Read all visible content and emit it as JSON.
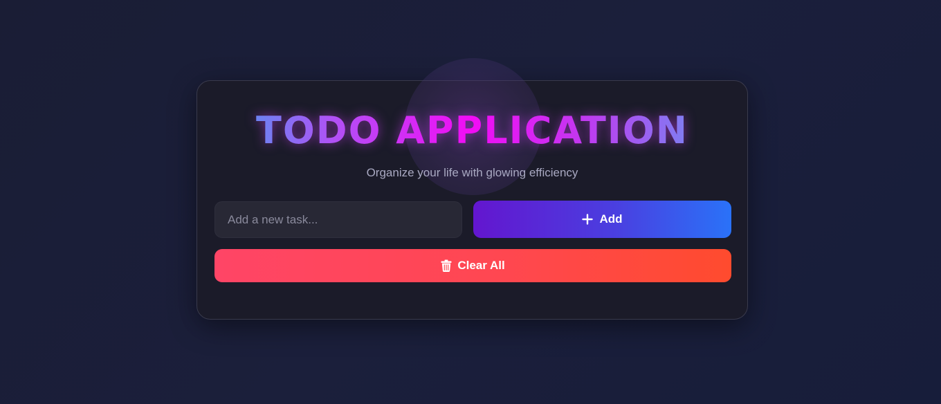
{
  "header": {
    "title": "TODO APPLICATION",
    "subtitle": "Organize your life with glowing efficiency"
  },
  "task_form": {
    "input_placeholder": "Add a new task...",
    "input_value": "",
    "add_label": "Add",
    "add_icon": "plus-icon"
  },
  "actions": {
    "clear_label": "Clear All",
    "clear_icon": "trash-icon"
  },
  "colors": {
    "page_background": "#1b1f3b",
    "card_background": "#1b1b29",
    "add_gradient_start": "#6316cf",
    "add_gradient_end": "#2a72f8",
    "clear_gradient_start": "#ff4566",
    "clear_gradient_end": "#ff4b2e",
    "title_accent": "#f20cf5"
  }
}
